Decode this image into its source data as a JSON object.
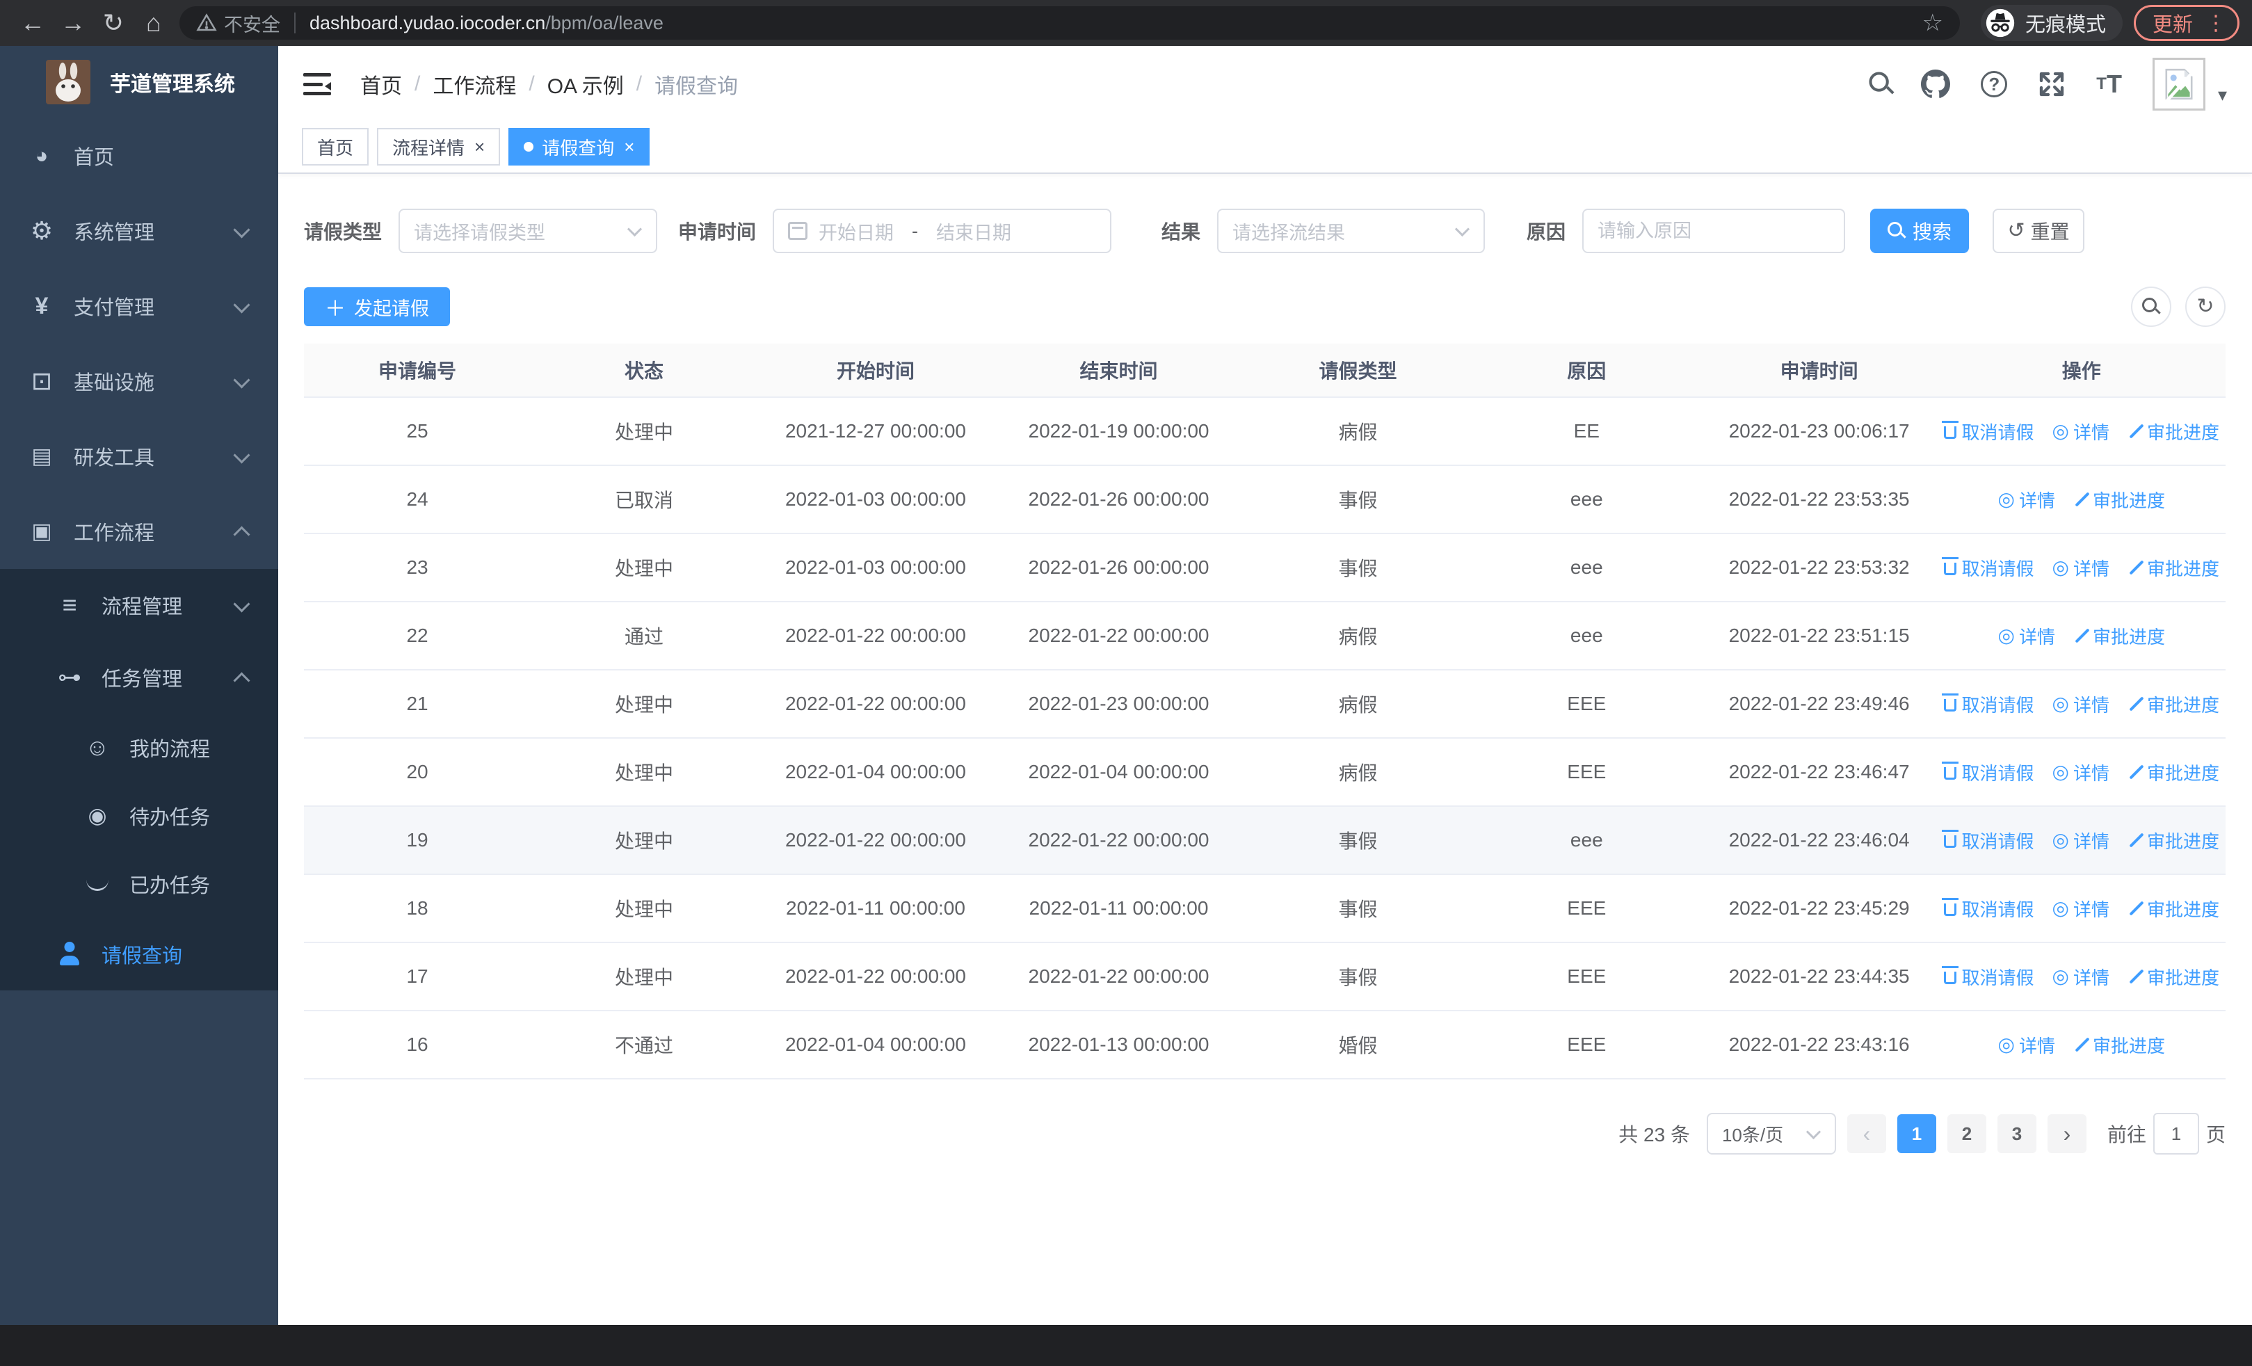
{
  "browser": {
    "back_icon": "←",
    "forward_icon": "→",
    "reload_icon": "↻",
    "home_icon": "⌂",
    "security_label": "不安全",
    "url_host": "dashboard.yudao.iocoder.cn",
    "url_path": "/bpm/oa/leave",
    "bookmark_star": "☆",
    "incognito_label": "无痕模式",
    "update_label": "更新",
    "menu_dots": "⋮"
  },
  "sidebar": {
    "title": "芋道管理系统",
    "items": [
      {
        "name": "home",
        "label": "首页",
        "icon": "dashboard-icon",
        "level": 1,
        "chevron": "none",
        "sub": false,
        "active": false
      },
      {
        "name": "system-management",
        "label": "系统管理",
        "icon": "gear-icon",
        "level": 1,
        "chevron": "down",
        "sub": false,
        "active": false
      },
      {
        "name": "payment-management",
        "label": "支付管理",
        "icon": "yen-icon",
        "level": 1,
        "chevron": "down",
        "sub": false,
        "active": false
      },
      {
        "name": "infrastructure",
        "label": "基础设施",
        "icon": "monitor-icon",
        "level": 1,
        "chevron": "down",
        "sub": false,
        "active": false
      },
      {
        "name": "dev-tools",
        "label": "研发工具",
        "icon": "tools-icon",
        "level": 1,
        "chevron": "down",
        "sub": false,
        "active": false
      },
      {
        "name": "workflow",
        "label": "工作流程",
        "icon": "briefcase-icon",
        "level": 1,
        "chevron": "up",
        "sub": false,
        "active": false
      },
      {
        "name": "process-management",
        "label": "流程管理",
        "icon": "list-icon",
        "level": 2,
        "chevron": "down",
        "sub": true,
        "active": false
      },
      {
        "name": "task-management",
        "label": "任务管理",
        "icon": "flow-icon",
        "level": 2,
        "chevron": "up",
        "sub": true,
        "active": false
      },
      {
        "name": "my-processes",
        "label": "我的流程",
        "icon": "robot-icon",
        "level": 3,
        "chevron": "none",
        "sub": true,
        "active": false
      },
      {
        "name": "todo-tasks",
        "label": "待办任务",
        "icon": "eye-open-icon",
        "level": 3,
        "chevron": "none",
        "sub": true,
        "active": false
      },
      {
        "name": "done-tasks",
        "label": "已办任务",
        "icon": "eye-closed-icon",
        "level": 3,
        "chevron": "none",
        "sub": true,
        "active": false
      },
      {
        "name": "leave-query",
        "label": "请假查询",
        "icon": "user-icon",
        "level": 2,
        "chevron": "none",
        "sub": true,
        "active": true
      }
    ]
  },
  "breadcrumb": {
    "separator": "/",
    "items": [
      "首页",
      "工作流程",
      "OA 示例",
      "请假查询"
    ]
  },
  "tabs": [
    {
      "name": "home",
      "label": "首页",
      "closable": false,
      "active": false
    },
    {
      "name": "process-detail",
      "label": "流程详情",
      "closable": true,
      "active": false
    },
    {
      "name": "leave-query",
      "label": "请假查询",
      "closable": true,
      "active": true
    }
  ],
  "filters": {
    "leave_type_label": "请假类型",
    "leave_type_placeholder": "请选择请假类型",
    "apply_time_label": "申请时间",
    "start_date_placeholder": "开始日期",
    "range_separator": "-",
    "end_date_placeholder": "结束日期",
    "result_label": "结果",
    "result_placeholder": "请选择流结果",
    "reason_label": "原因",
    "reason_placeholder": "请输入原因",
    "search_label": "搜索",
    "reset_label": "重置"
  },
  "toolbar": {
    "create_label": "发起请假"
  },
  "table": {
    "columns": [
      "申请编号",
      "状态",
      "开始时间",
      "结束时间",
      "请假类型",
      "原因",
      "申请时间",
      "操作"
    ],
    "action_labels": {
      "cancel": "取消请假",
      "detail": "详情",
      "progress": "审批进度"
    },
    "rows": [
      {
        "id": "25",
        "status": "处理中",
        "start": "2021-12-27 00:00:00",
        "end": "2022-01-19 00:00:00",
        "type": "病假",
        "reason": "EE",
        "applied": "2022-01-23 00:06:17",
        "actions": [
          "cancel",
          "detail",
          "progress"
        ],
        "hover": false
      },
      {
        "id": "24",
        "status": "已取消",
        "start": "2022-01-03 00:00:00",
        "end": "2022-01-26 00:00:00",
        "type": "事假",
        "reason": "eee",
        "applied": "2022-01-22 23:53:35",
        "actions": [
          "detail",
          "progress"
        ],
        "hover": false
      },
      {
        "id": "23",
        "status": "处理中",
        "start": "2022-01-03 00:00:00",
        "end": "2022-01-26 00:00:00",
        "type": "事假",
        "reason": "eee",
        "applied": "2022-01-22 23:53:32",
        "actions": [
          "cancel",
          "detail",
          "progress"
        ],
        "hover": false
      },
      {
        "id": "22",
        "status": "通过",
        "start": "2022-01-22 00:00:00",
        "end": "2022-01-22 00:00:00",
        "type": "病假",
        "reason": "eee",
        "applied": "2022-01-22 23:51:15",
        "actions": [
          "detail",
          "progress"
        ],
        "hover": false
      },
      {
        "id": "21",
        "status": "处理中",
        "start": "2022-01-22 00:00:00",
        "end": "2022-01-23 00:00:00",
        "type": "病假",
        "reason": "EEE",
        "applied": "2022-01-22 23:49:46",
        "actions": [
          "cancel",
          "detail",
          "progress"
        ],
        "hover": false
      },
      {
        "id": "20",
        "status": "处理中",
        "start": "2022-01-04 00:00:00",
        "end": "2022-01-04 00:00:00",
        "type": "病假",
        "reason": "EEE",
        "applied": "2022-01-22 23:46:47",
        "actions": [
          "cancel",
          "detail",
          "progress"
        ],
        "hover": false
      },
      {
        "id": "19",
        "status": "处理中",
        "start": "2022-01-22 00:00:00",
        "end": "2022-01-22 00:00:00",
        "type": "事假",
        "reason": "eee",
        "applied": "2022-01-22 23:46:04",
        "actions": [
          "cancel",
          "detail",
          "progress"
        ],
        "hover": true
      },
      {
        "id": "18",
        "status": "处理中",
        "start": "2022-01-11 00:00:00",
        "end": "2022-01-11 00:00:00",
        "type": "事假",
        "reason": "EEE",
        "applied": "2022-01-22 23:45:29",
        "actions": [
          "cancel",
          "detail",
          "progress"
        ],
        "hover": false
      },
      {
        "id": "17",
        "status": "处理中",
        "start": "2022-01-22 00:00:00",
        "end": "2022-01-22 00:00:00",
        "type": "事假",
        "reason": "EEE",
        "applied": "2022-01-22 23:44:35",
        "actions": [
          "cancel",
          "detail",
          "progress"
        ],
        "hover": false
      },
      {
        "id": "16",
        "status": "不通过",
        "start": "2022-01-04 00:00:00",
        "end": "2022-01-13 00:00:00",
        "type": "婚假",
        "reason": "EEE",
        "applied": "2022-01-22 23:43:16",
        "actions": [
          "detail",
          "progress"
        ],
        "hover": false
      }
    ]
  },
  "pagination": {
    "total_label": "共 23 条",
    "page_size_label": "10条/页",
    "prev_icon": "‹",
    "next_icon": "›",
    "pages": [
      "1",
      "2",
      "3"
    ],
    "active_page": "1",
    "goto_label": "前往",
    "goto_value": "1",
    "page_unit_label": "页"
  },
  "colors": {
    "primary": "#409eff",
    "sidebar_bg": "#304156",
    "submenu_bg": "#1f2d3d",
    "update_accent": "#f28b82",
    "table_header_bg": "#fafafa"
  }
}
